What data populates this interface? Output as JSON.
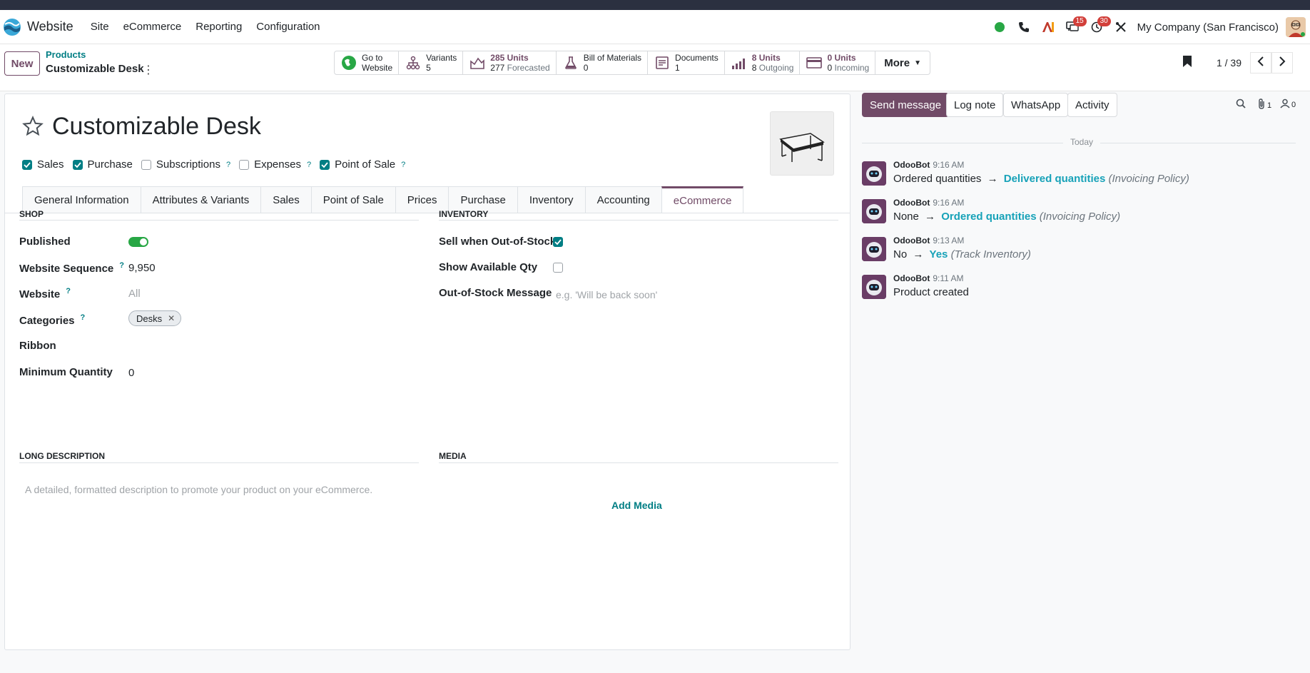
{
  "navbar": {
    "app_name": "Website",
    "menu": [
      "Site",
      "eCommerce",
      "Reporting",
      "Configuration"
    ],
    "discuss_badge": "15",
    "activity_badge": "30",
    "company": "My Company (San Francisco)"
  },
  "control": {
    "new_label": "New",
    "breadcrumb_parent": "Products",
    "breadcrumb_current": "Customizable Desk",
    "stats": {
      "website": {
        "l1": "Go to",
        "l2": "Website"
      },
      "variants": {
        "l1": "Variants",
        "l2": "5"
      },
      "onhand": {
        "l1": "285 Units",
        "l2a": "277",
        "l2b": "Forecasted"
      },
      "bom": {
        "l1": "Bill of Materials",
        "l2": "0"
      },
      "documents": {
        "l1": "Documents",
        "l2": "1"
      },
      "outgoing": {
        "l1": "8 Units",
        "l2a": "8",
        "l2b": "Outgoing"
      },
      "incoming": {
        "l1": "0 Units",
        "l2a": "0",
        "l2b": "Incoming"
      }
    },
    "more_label": "More",
    "pager": "1 / 39"
  },
  "form": {
    "title": "Customizable Desk",
    "options": [
      {
        "label": "Sales",
        "checked": true,
        "help": false
      },
      {
        "label": "Purchase",
        "checked": true,
        "help": false
      },
      {
        "label": "Subscriptions",
        "checked": false,
        "help": true
      },
      {
        "label": "Expenses",
        "checked": false,
        "help": true
      },
      {
        "label": "Point of Sale",
        "checked": true,
        "help": true
      }
    ],
    "help_mark": "?",
    "tabs": [
      "General Information",
      "Attributes & Variants",
      "Sales",
      "Point of Sale",
      "Prices",
      "Purchase",
      "Inventory",
      "Accounting",
      "eCommerce"
    ],
    "active_tab": "eCommerce",
    "shop": {
      "title": "SHOP",
      "published_label": "Published",
      "published": true,
      "sequence_label": "Website Sequence",
      "sequence_value": "9,950",
      "website_label": "Website",
      "website_placeholder": "All",
      "categories_label": "Categories",
      "category_tag": "Desks",
      "ribbon_label": "Ribbon",
      "min_qty_label": "Minimum Quantity",
      "min_qty_value": "0"
    },
    "inventory": {
      "title": "INVENTORY",
      "sell_oos_label": "Sell when Out-of-Stock",
      "sell_oos": true,
      "show_qty_label": "Show Available Qty",
      "show_qty": false,
      "oos_msg_label": "Out-of-Stock Message",
      "oos_msg_placeholder": "e.g. 'Will be back soon'"
    },
    "long_desc": {
      "title": "LONG DESCRIPTION",
      "placeholder": "A detailed, formatted description to promote your product on your eCommerce."
    },
    "media": {
      "title": "MEDIA",
      "add_label": "Add Media"
    }
  },
  "chatter": {
    "send_message": "Send message",
    "log_note": "Log note",
    "whatsapp": "WhatsApp",
    "activity": "Activity",
    "attachments_count": "1",
    "followers_count": "0",
    "today": "Today",
    "arrow": "→",
    "messages": [
      {
        "author": "OdooBot",
        "time": "9:16 AM",
        "old": "Ordered quantities",
        "new": "Delivered quantities",
        "field": "(Invoicing Policy)"
      },
      {
        "author": "OdooBot",
        "time": "9:16 AM",
        "old": "None",
        "new": "Ordered quantities",
        "field": "(Invoicing Policy)"
      },
      {
        "author": "OdooBot",
        "time": "9:13 AM",
        "old": "No",
        "new": "Yes",
        "field": "(Track Inventory)"
      },
      {
        "author": "OdooBot",
        "time": "9:11 AM",
        "text": "Product created"
      }
    ]
  },
  "colors": {
    "brand": "#714b67",
    "teal": "#017e84",
    "link_new": "#17a2b8",
    "badge": "#d23f3a"
  }
}
